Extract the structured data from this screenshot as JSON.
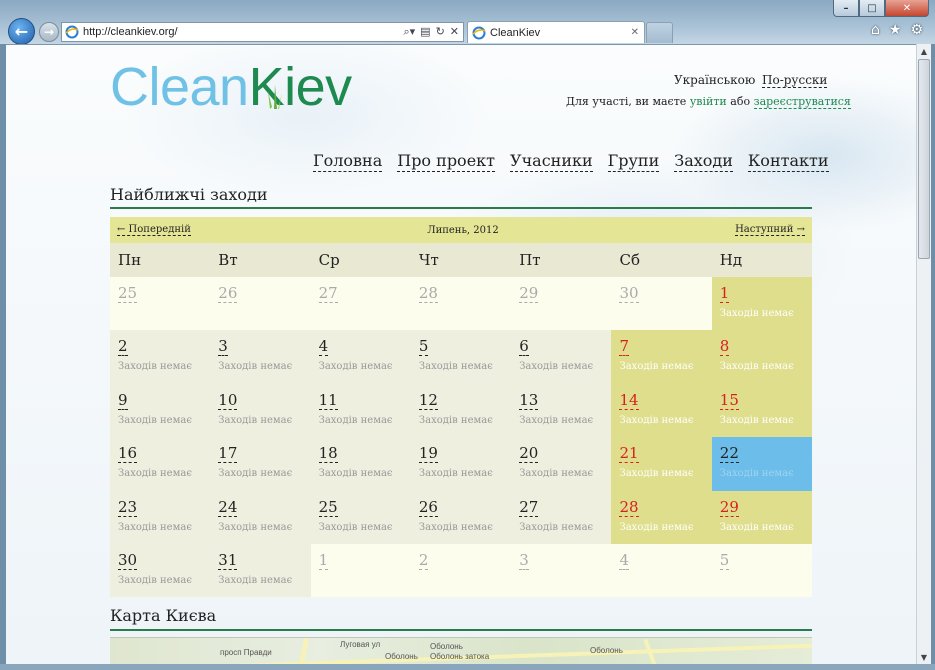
{
  "browser": {
    "url": "http://cleankiev.org/",
    "tab_title": "CleanKiev",
    "window_buttons": {
      "min": "–",
      "max": "□",
      "close": "✕"
    }
  },
  "header": {
    "logo_clean": "Clean",
    "logo_kiev": "Kiev",
    "lang_ua": "Українською",
    "lang_ru": "По-русски",
    "auth_prefix": "Для участі, ви маєте",
    "auth_login": "увійти",
    "auth_or": "або",
    "auth_register": "зареєструватися"
  },
  "nav": [
    "Головна",
    "Про проект",
    "Учасники",
    "Групи",
    "Заходи",
    "Контакти"
  ],
  "events_section": {
    "title": "Найближчі заходи",
    "prev": "← Попередній",
    "month": "Липень, 2012",
    "next": "Наступний →",
    "weekdays": [
      "Пн",
      "Вт",
      "Ср",
      "Чт",
      "Пт",
      "Сб",
      "Нд"
    ],
    "no_events": "Заходів немає",
    "weeks": [
      [
        {
          "d": "25",
          "t": "other"
        },
        {
          "d": "26",
          "t": "other"
        },
        {
          "d": "27",
          "t": "other"
        },
        {
          "d": "28",
          "t": "other"
        },
        {
          "d": "29",
          "t": "other"
        },
        {
          "d": "30",
          "t": "other"
        },
        {
          "d": "1",
          "t": "we",
          "e": true
        }
      ],
      [
        {
          "d": "2",
          "t": "cur",
          "e": true
        },
        {
          "d": "3",
          "t": "cur",
          "e": true
        },
        {
          "d": "4",
          "t": "cur",
          "e": true
        },
        {
          "d": "5",
          "t": "cur",
          "e": true
        },
        {
          "d": "6",
          "t": "cur",
          "e": true
        },
        {
          "d": "7",
          "t": "we",
          "e": true
        },
        {
          "d": "8",
          "t": "we",
          "e": true
        }
      ],
      [
        {
          "d": "9",
          "t": "cur",
          "e": true
        },
        {
          "d": "10",
          "t": "cur",
          "e": true
        },
        {
          "d": "11",
          "t": "cur",
          "e": true
        },
        {
          "d": "12",
          "t": "cur",
          "e": true
        },
        {
          "d": "13",
          "t": "cur",
          "e": true
        },
        {
          "d": "14",
          "t": "we",
          "e": true
        },
        {
          "d": "15",
          "t": "we",
          "e": true
        }
      ],
      [
        {
          "d": "16",
          "t": "cur",
          "e": true
        },
        {
          "d": "17",
          "t": "cur",
          "e": true
        },
        {
          "d": "18",
          "t": "cur",
          "e": true
        },
        {
          "d": "19",
          "t": "cur",
          "e": true
        },
        {
          "d": "20",
          "t": "cur",
          "e": true
        },
        {
          "d": "21",
          "t": "we",
          "e": true
        },
        {
          "d": "22",
          "t": "today",
          "e": true
        }
      ],
      [
        {
          "d": "23",
          "t": "cur",
          "e": true
        },
        {
          "d": "24",
          "t": "cur",
          "e": true
        },
        {
          "d": "25",
          "t": "cur",
          "e": true
        },
        {
          "d": "26",
          "t": "cur",
          "e": true
        },
        {
          "d": "27",
          "t": "cur",
          "e": true
        },
        {
          "d": "28",
          "t": "we",
          "e": true
        },
        {
          "d": "29",
          "t": "we",
          "e": true
        }
      ],
      [
        {
          "d": "30",
          "t": "cur",
          "e": true
        },
        {
          "d": "31",
          "t": "cur",
          "e": true
        },
        {
          "d": "1",
          "t": "other"
        },
        {
          "d": "2",
          "t": "other"
        },
        {
          "d": "3",
          "t": "other"
        },
        {
          "d": "4",
          "t": "other"
        },
        {
          "d": "5",
          "t": "other"
        }
      ]
    ]
  },
  "map_section": {
    "title": "Карта Києва",
    "labels": [
      "просп Правди",
      "Луговая ул",
      "Оболонь",
      "Оболонь",
      "Оболонь затока",
      "Оболонь"
    ]
  },
  "colors": {
    "brand_light": "#6fc2e6",
    "brand_dark": "#1e8a4f",
    "weekend_cell": "#dede8c",
    "weekend_number": "#d82020",
    "today_cell": "#6cbdea"
  }
}
